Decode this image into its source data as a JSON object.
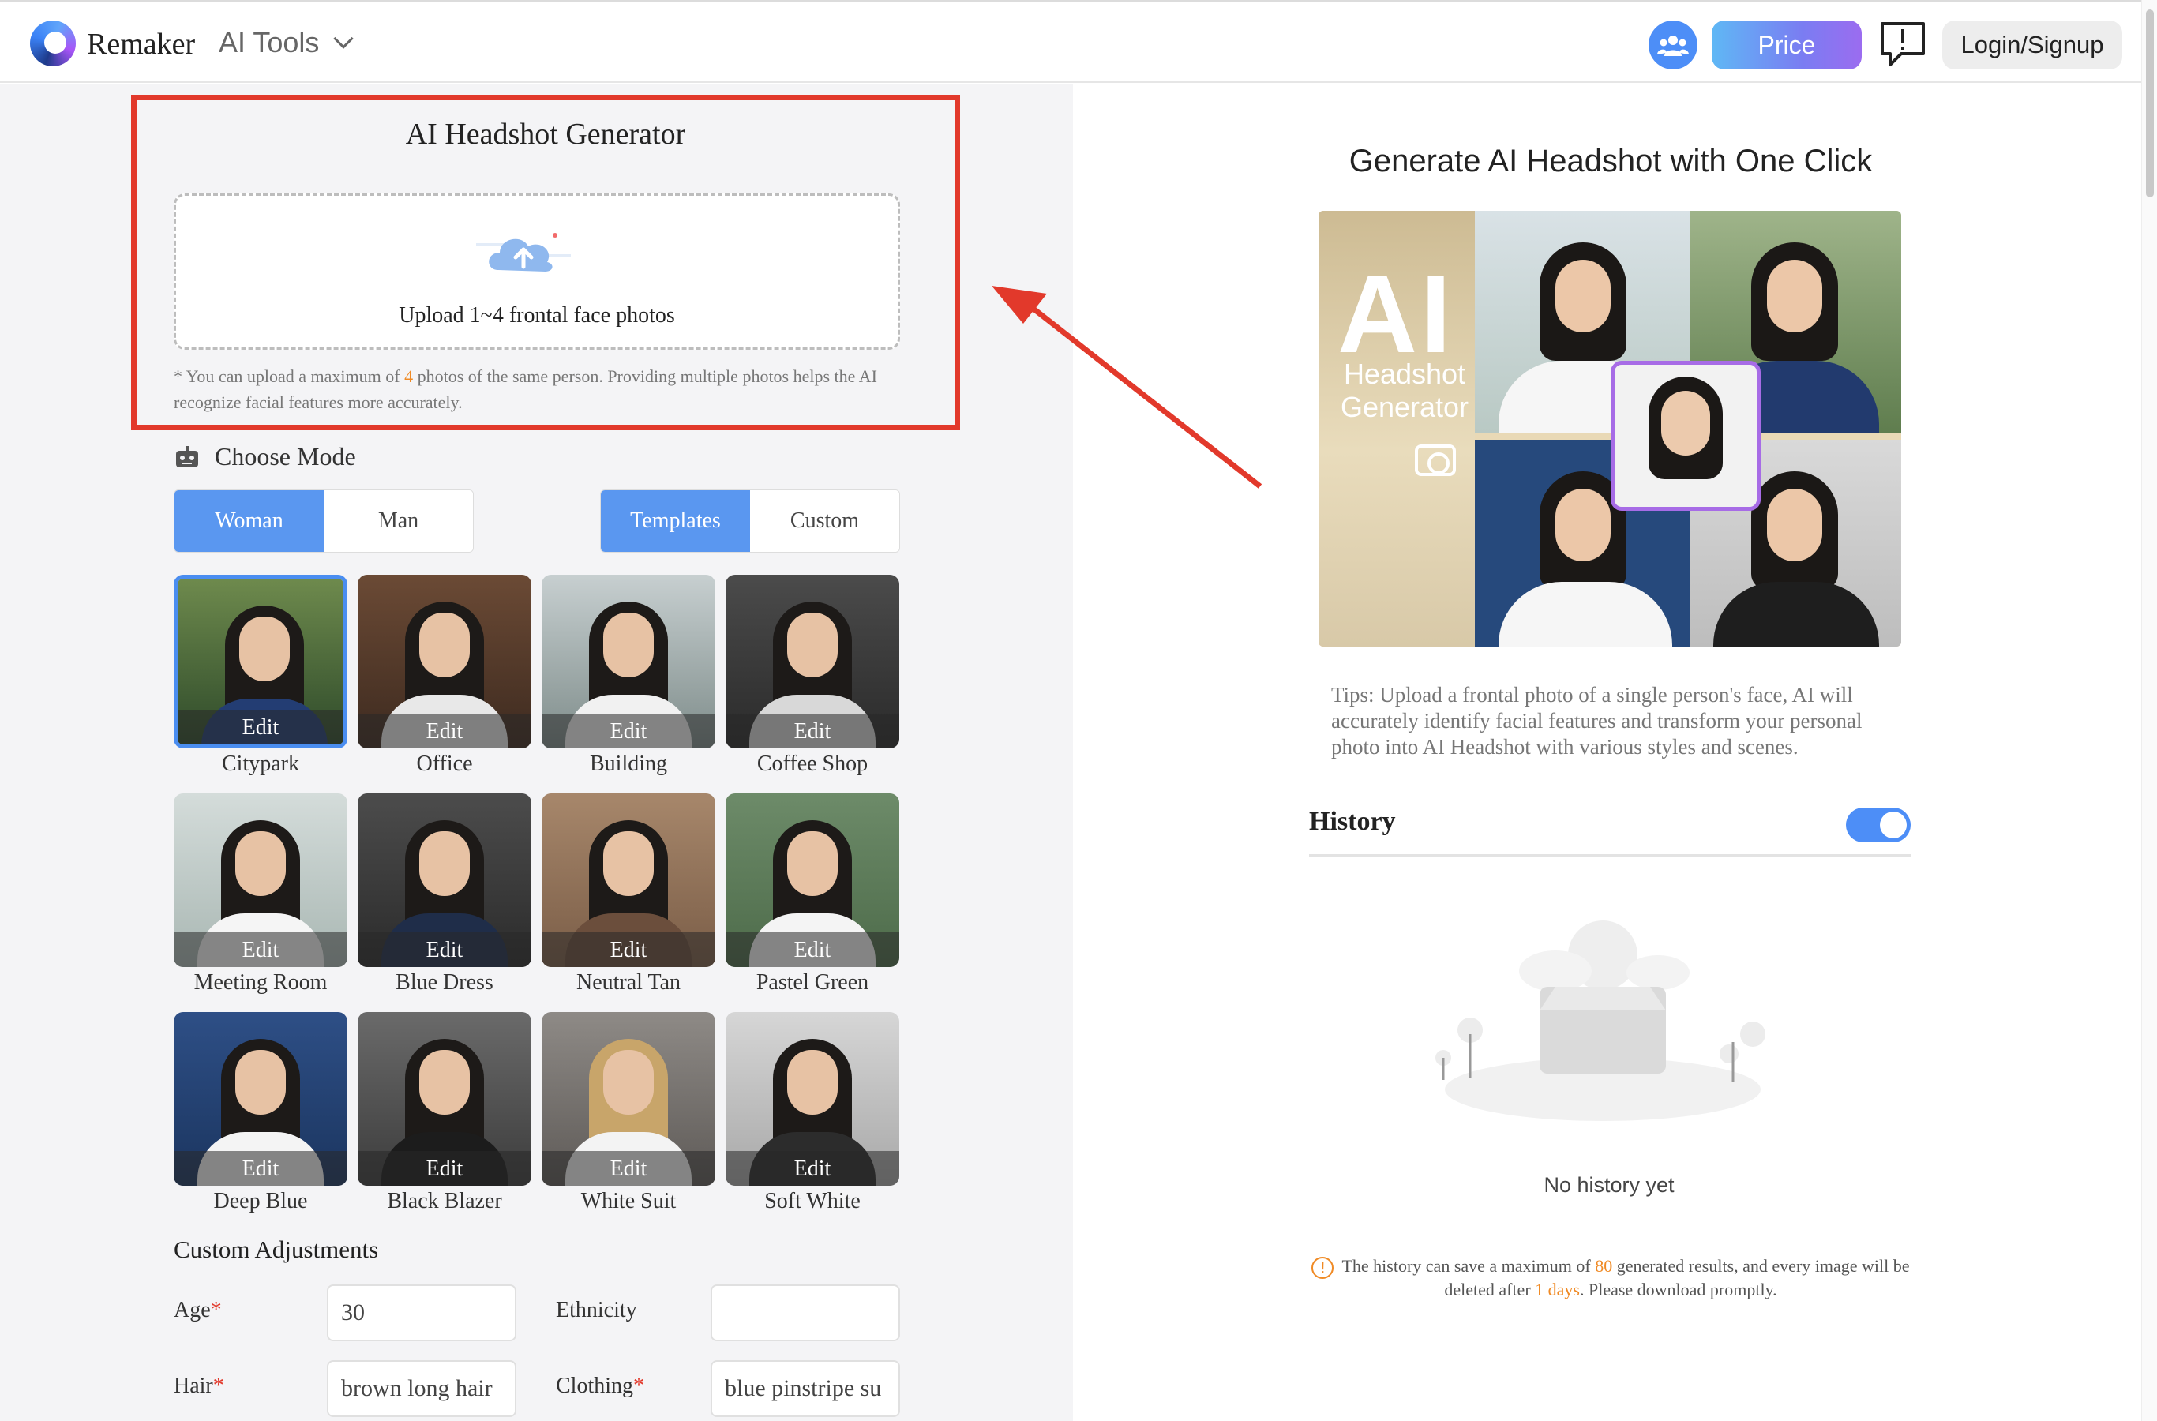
{
  "header": {
    "brand": "Remaker",
    "tools_menu": "AI Tools",
    "price_label": "Price",
    "login_label": "Login/Signup",
    "icons": [
      "community-icon",
      "feedback-icon",
      "chevron-down-icon"
    ]
  },
  "generator": {
    "title": "AI Headshot Generator",
    "upload_label": "Upload 1~4 frontal face photos",
    "note_prefix": "* You can upload a maximum of ",
    "note_count": "4",
    "note_suffix": " photos of the same person. Providing multiple photos helps the AI recognize facial features more accurately.",
    "choose_mode": "Choose Mode",
    "gender_options": [
      "Woman",
      "Man"
    ],
    "gender_selected": "Woman",
    "type_options": [
      "Templates",
      "Custom"
    ],
    "type_selected": "Templates",
    "edit_label": "Edit",
    "templates": [
      {
        "name": "Citypark",
        "selected": true
      },
      {
        "name": "Office"
      },
      {
        "name": "Building"
      },
      {
        "name": "Coffee Shop"
      },
      {
        "name": "Meeting Room"
      },
      {
        "name": "Blue Dress"
      },
      {
        "name": "Neutral Tan"
      },
      {
        "name": "Pastel Green"
      },
      {
        "name": "Deep Blue"
      },
      {
        "name": "Black Blazer"
      },
      {
        "name": "White Suit"
      },
      {
        "name": "Soft White"
      }
    ],
    "custom_title": "Custom Adjustments",
    "fields": {
      "age_label": "Age",
      "age_value": "30",
      "ethnicity_label": "Ethnicity",
      "ethnicity_value": "",
      "hair_label": "Hair",
      "hair_value": "brown long hair",
      "clothing_label": "Clothing",
      "clothing_value": "blue pinstripe su"
    },
    "required_mark": "*"
  },
  "right": {
    "title": "Generate AI Headshot with One Click",
    "hero_big": "AI",
    "hero_sub_1": "Headshot",
    "hero_sub_2": "Generator",
    "tips": "Tips: Upload a frontal photo of a single person's face, AI will accurately identify facial features and transform your personal photo into AI Headshot with various styles and scenes.",
    "history_title": "History",
    "history_toggle_on": true,
    "empty_text": "No history yet",
    "limit_prefix": "The history can save a maximum of ",
    "limit_count": "80",
    "limit_mid": " generated results, and every image will be deleted after ",
    "limit_days": "1 days",
    "limit_suffix": ". Please download promptly."
  },
  "colors": {
    "accent": "#5a97f0",
    "highlight": "#e2392b",
    "orange": "#f08a24"
  }
}
